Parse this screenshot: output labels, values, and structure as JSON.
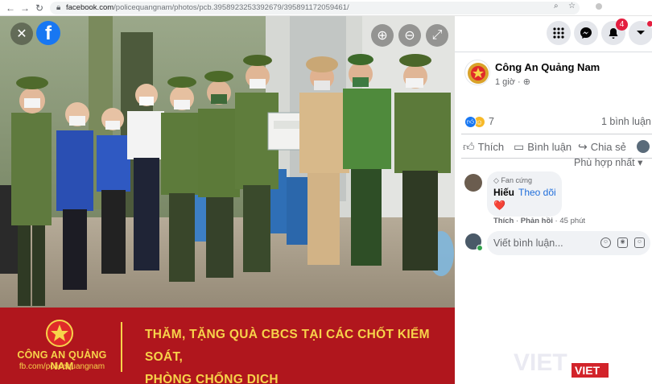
{
  "browser": {
    "url_host": "facebook.com",
    "url_path": "/policequangnam/photos/pcb.3958923253392679/3958911720594​61/"
  },
  "banner": {
    "org_name": "CÔNG AN QUẢNG NAM",
    "site": "fb.com/policequangnam",
    "headline_line1": "THĂM, TẶNG QUÀ CBCS TẠI CÁC CHỐT KIỂM SOÁT,",
    "headline_line2": "PHÒNG CHỐNG DỊCH",
    "colors": {
      "banner_red": "#b0161d",
      "banner_gold": "#f7d34a"
    }
  },
  "top_bar": {
    "notifications_count": "4"
  },
  "post": {
    "page_name": "Công An Quảng Nam",
    "time": "1 giờ",
    "reactions_count": "7",
    "comments_count": "1 bình luận",
    "actions": {
      "like": "Thích",
      "comment": "Bình luận",
      "share": "Chia sẻ"
    },
    "sort_label": "Phù hợp nhất"
  },
  "comment": {
    "fan_badge": "Fan cứng",
    "author": "Hiếu",
    "follow": "Theo dõi",
    "content": "❤️",
    "like": "Thích",
    "reply": "Phản hồi",
    "time": "45 phút"
  },
  "composer": {
    "placeholder": "Viết bình luận..."
  },
  "watermark": {
    "big": "VIET",
    "small": "VIET"
  },
  "colors": {
    "fb_blue": "#1877f2",
    "link_blue": "#216fdb"
  }
}
